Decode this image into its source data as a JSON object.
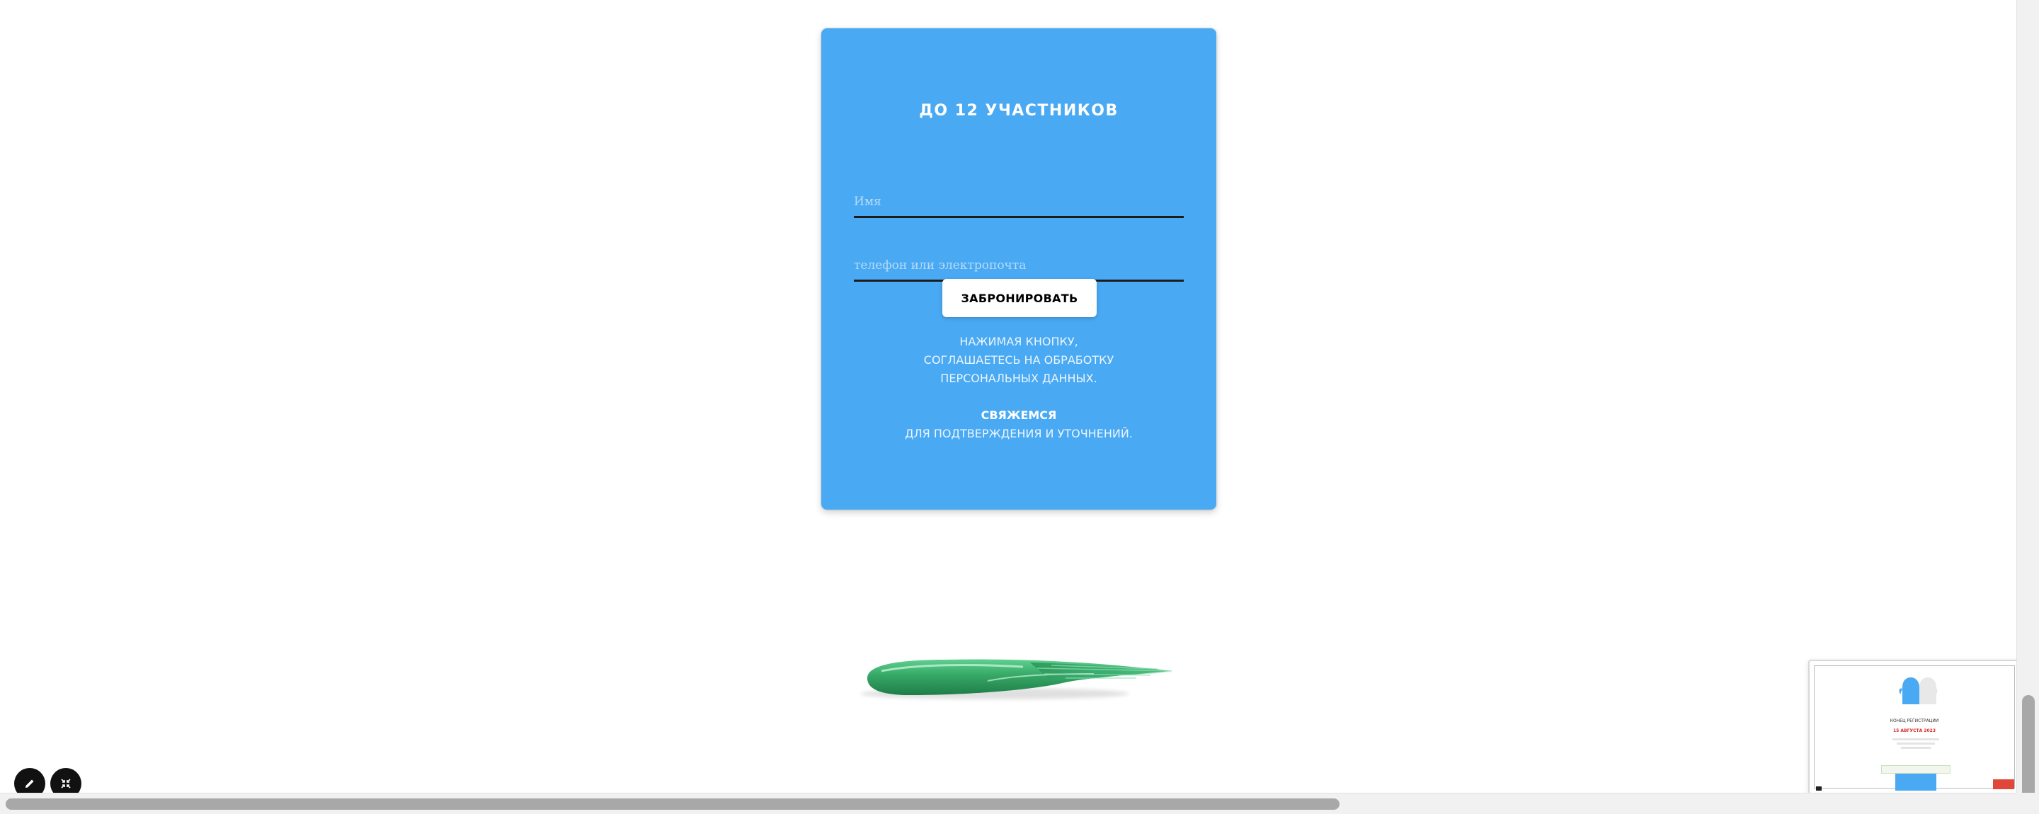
{
  "booking_card": {
    "title": "ДО 12 УЧАСТНИКОВ",
    "name_placeholder": "Имя",
    "contact_placeholder": "телефон или электропочта",
    "submit_label": "ЗАБРОНИРОВАТЬ",
    "consent_lines": [
      "НАЖИМАЯ КНОПКУ,",
      "СОГЛАШАЕТЕСЬ НА ОБРАБОТКУ",
      "ПЕРСОНАЛЬНЫХ ДАННЫХ."
    ],
    "contact_heading": "СВЯЖЕМСЯ",
    "contact_text": "ДЛЯ ПОДТВЕРЖДЕНИЯ И УТОЧНЕНИЙ."
  },
  "editor_controls": {
    "edit_icon": "pencil-icon",
    "collapse_icon": "collapse-arrows-icon"
  },
  "minimap": {
    "line1": "КОНЕЦ РЕГИСТРАЦИИ",
    "line2": "15 АВГУСТА 2023"
  },
  "colors": {
    "card_background": "#4aa9f3",
    "card_text": "#ffffff",
    "button_background": "#ffffff",
    "field_underline": "#1c1c1c",
    "brush_stroke": "#3cab6e",
    "fab_background": "#111111"
  }
}
